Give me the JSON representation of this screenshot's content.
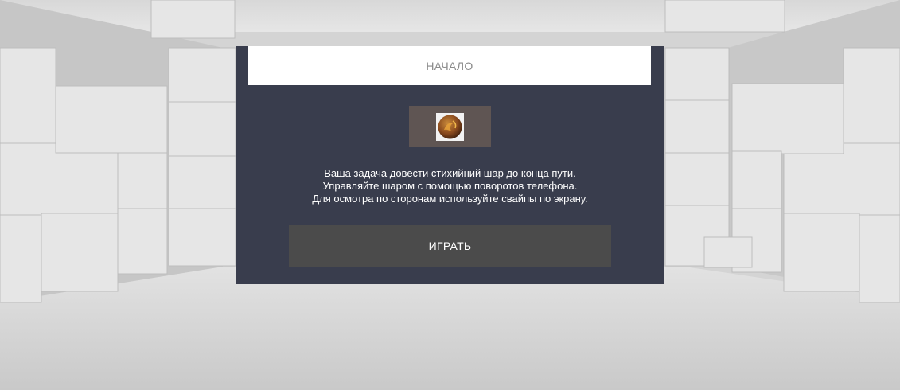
{
  "dialog": {
    "title": "НАЧАЛО",
    "ball_icon": "elemental-ball-icon",
    "instructions": [
      "Ваша задача довести стихийний шар до конца пути.",
      "Управляйте шаром с помощью поворотов телефона.",
      "Для осмотра по сторонам используйте свайпы по экрану."
    ],
    "play_label": "ИГРАТЬ"
  },
  "colors": {
    "panel": "#393d4d",
    "header": "#ffffff",
    "header_text": "#8a8a8a",
    "ball_slot": "#5f5553",
    "play_button": "#4b4b4b",
    "room": "#cfcfcf"
  }
}
